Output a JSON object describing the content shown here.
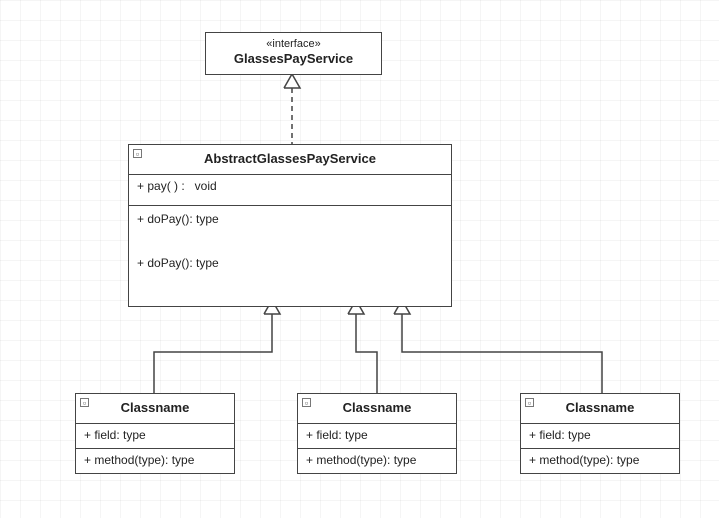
{
  "interface": {
    "stereotype": "«interface»",
    "name": "GlassesPayService"
  },
  "abstract": {
    "name": "AbstractGlassesPayService",
    "methods_top": [
      "+ pay( ) :   void"
    ],
    "methods_bottom": [
      "+ doPay(): type",
      "+ doPay(): type"
    ]
  },
  "classes": [
    {
      "name": "Classname",
      "fields": [
        "+ field: type"
      ],
      "methods": [
        "+ method(type): type"
      ]
    },
    {
      "name": "Classname",
      "fields": [
        "+ field: type"
      ],
      "methods": [
        "+ method(type): type"
      ]
    },
    {
      "name": "Classname",
      "fields": [
        "+ field: type"
      ],
      "methods": [
        "+ method(type): type"
      ]
    }
  ],
  "expander_glyph": "▫"
}
